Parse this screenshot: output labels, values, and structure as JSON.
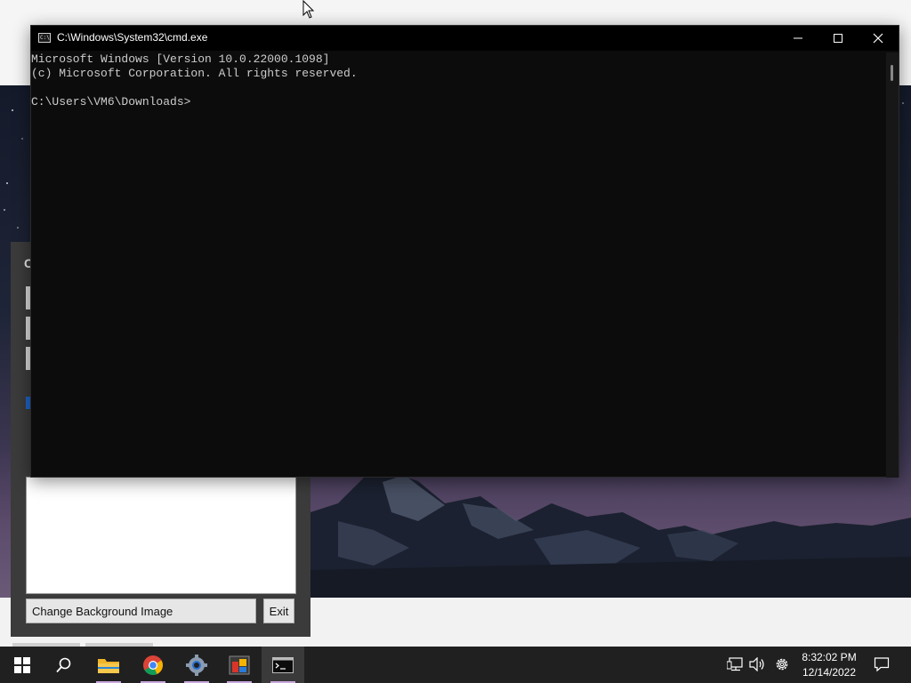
{
  "cmd": {
    "title": "C:\\Windows\\System32\\cmd.exe",
    "icon_text": "C:\\",
    "lines": [
      "Microsoft Windows [Version 10.0.22000.1098]",
      "(c) Microsoft Corporation. All rights reserved.",
      "",
      "C:\\Users\\VM6\\Downloads>"
    ]
  },
  "app": {
    "title_letter": "C",
    "change_bg_label": "Change Background Image",
    "exit_label": "Exit"
  },
  "taskbar": {
    "items": [
      "start-icon",
      "search-icon",
      "file-explorer-icon",
      "chrome-icon",
      "settings-app-icon",
      "app-icon",
      "terminal-icon"
    ],
    "active": "terminal-icon",
    "tray": [
      "network-icon",
      "volume-icon",
      "settings-icon"
    ],
    "time": "8:32:02 PM",
    "date": "12/14/2022",
    "notification_icon": "notification-icon"
  }
}
